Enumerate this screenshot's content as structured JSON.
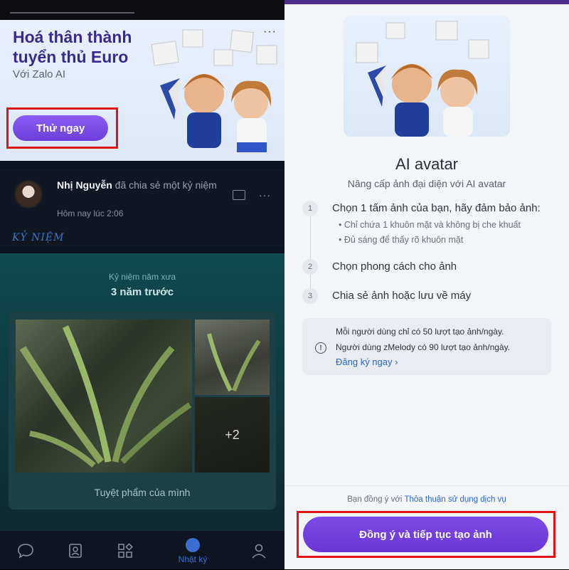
{
  "left": {
    "banner": {
      "title": "Hoá thân thành tuyển thủ Euro",
      "subtitle": "Với Zalo AI",
      "cta": "Thử ngay",
      "more": "···"
    },
    "post": {
      "author": "Nhị Nguyễn",
      "action": "đã chia sẻ một kỷ niệm",
      "time": "Hôm nay lúc 2:06",
      "more": "···",
      "tag": "KỶ NIỆM"
    },
    "memory": {
      "label": "Kỷ niệm năm xưa",
      "title": "3 năm trước",
      "more_count": "+2",
      "caption": "Tuyệt phẩm của mình"
    },
    "nav": {
      "items": [
        "chat-icon",
        "contacts-icon",
        "apps-icon",
        "diary-icon",
        "profile-icon"
      ],
      "active_label": "Nhật ký"
    }
  },
  "right": {
    "title": "AI avatar",
    "subtitle": "Nâng cấp ảnh đại diện với AI avatar",
    "steps": [
      {
        "num": "1",
        "text": "Chọn 1 tấm ảnh của bạn, hãy đảm bảo ảnh:"
      },
      {
        "num": "2",
        "text": "Chọn phong cách cho ảnh"
      },
      {
        "num": "3",
        "text": "Chia sẻ ảnh hoặc lưu về máy"
      }
    ],
    "step1_subs": [
      "Chỉ chứa 1 khuôn mặt và không bị che khuất",
      "Đủ sáng để thấy rõ khuôn mặt"
    ],
    "notice": {
      "line1": "Mỗi người dùng chỉ có 50 lượt tạo ảnh/ngày.",
      "line2": "Người dùng zMelody có 90 lượt tạo ảnh/ngày.",
      "link": "Đăng ký ngay",
      "icon": "!"
    },
    "terms_prefix": "Bạn đồng ý với",
    "terms_link": "Thỏa thuận sử dụng dịch vụ",
    "agree_button": "Đồng ý và tiếp tục tạo ảnh"
  },
  "colors": {
    "accent": "#6d3fd9",
    "highlight": "#e01414",
    "link": "#2a66c8"
  }
}
